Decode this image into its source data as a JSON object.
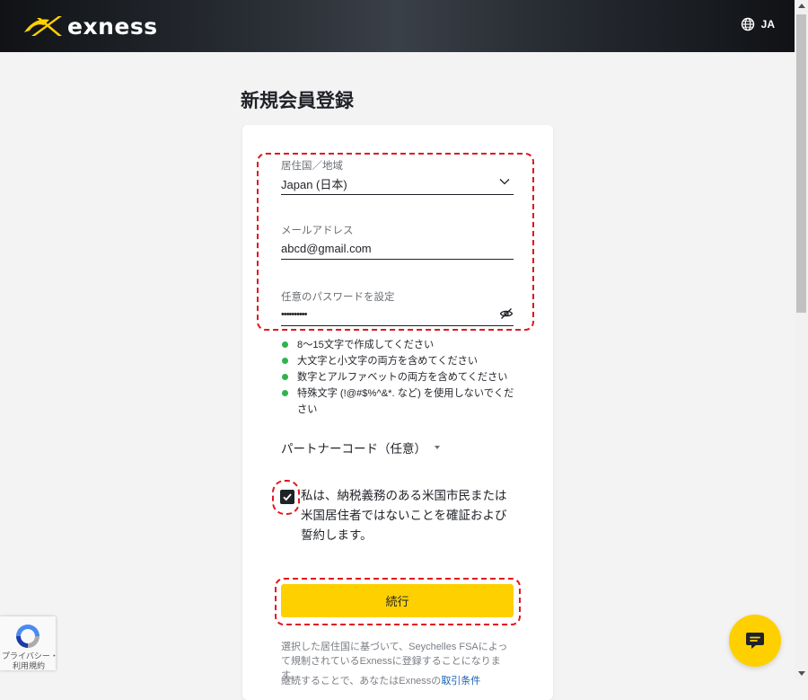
{
  "header": {
    "brand": "exness",
    "language": "JA",
    "brand_color": "#ffd000"
  },
  "page": {
    "title": "新規会員登録"
  },
  "form": {
    "country": {
      "label": "居住国／地域",
      "value": "Japan (日本)"
    },
    "email": {
      "label": "メールアドレス",
      "value": "abcd@gmail.com"
    },
    "password": {
      "label": "任意のパスワードを設定",
      "value": "••••••••••"
    },
    "rules": [
      "8〜15文字で作成してください",
      "大文字と小文字の両方を含めてください",
      "数字とアルファベットの両方を含めてください",
      "特殊文字 (!@#$%^&*. など) を使用しないでください"
    ],
    "partner_code_label": "パートナーコード（任意）",
    "consent_text": "私は、納税義務のある米国市民または米国居住者ではないことを確証および誓約します。",
    "consent_checked": true,
    "continue_label": "続行",
    "notice": "選択した居住国に基づいて、Seychelles FSAによって規制されているExnessに登録することになります。",
    "notice2_prefix": "継続することで、あなたはExnessの",
    "notice2_link": "取引条件"
  },
  "recaptcha": {
    "privacy": "プライバシー・",
    "terms": "利用規約"
  },
  "icons": {
    "language": "globe-icon",
    "select": "chevron-down-icon",
    "password_toggle": "eye-off-icon",
    "chat": "chat-icon"
  },
  "colors": {
    "accent": "#ffd000",
    "highlight": "#e0161e",
    "rule_ok": "#2eb34e"
  }
}
